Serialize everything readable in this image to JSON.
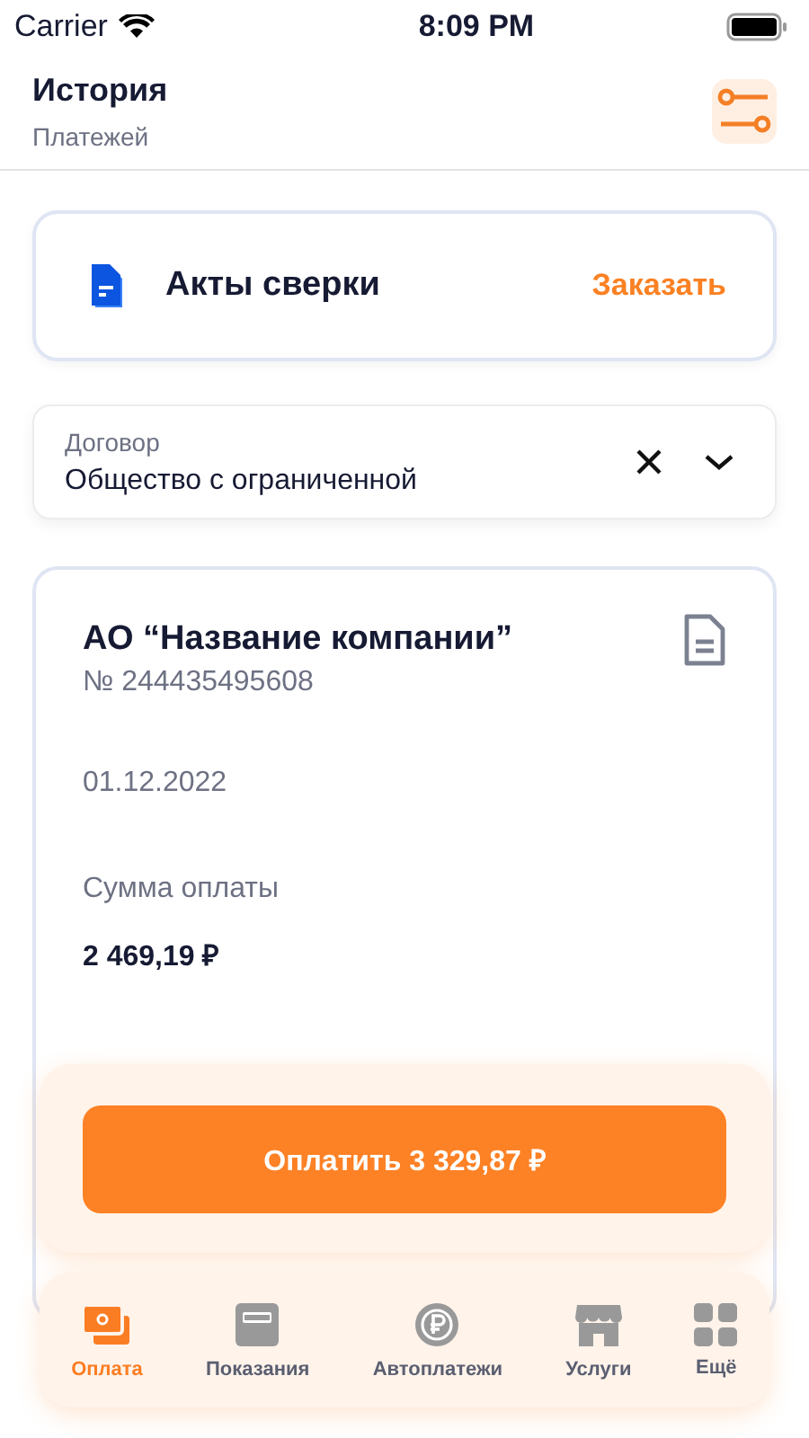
{
  "status_bar": {
    "carrier": "Carrier",
    "time": "8:09 PM"
  },
  "header": {
    "title": "История",
    "subtitle": "Платежей"
  },
  "acts_card": {
    "title": "Акты сверки",
    "action": "Заказать"
  },
  "contract_field": {
    "label": "Договор",
    "value": "Общество с ограниченной"
  },
  "payment_card": {
    "company": "АО “Название компании”",
    "number": "№ 244435495608",
    "date": "01.12.2022",
    "amount_label": "Сумма оплаты",
    "amount": "2 469,19 ₽"
  },
  "pay_button": "Оплатить 3 329,87 ₽",
  "tabs": [
    {
      "label": "Оплата",
      "kind": "wallet",
      "selected": true
    },
    {
      "label": "Показания",
      "kind": "meter",
      "selected": false
    },
    {
      "label": "Автоплатежи",
      "kind": "autopay",
      "selected": false
    },
    {
      "label": "Услуги",
      "kind": "shop",
      "selected": false
    },
    {
      "label": "Ещё",
      "kind": "grid",
      "selected": false
    }
  ]
}
